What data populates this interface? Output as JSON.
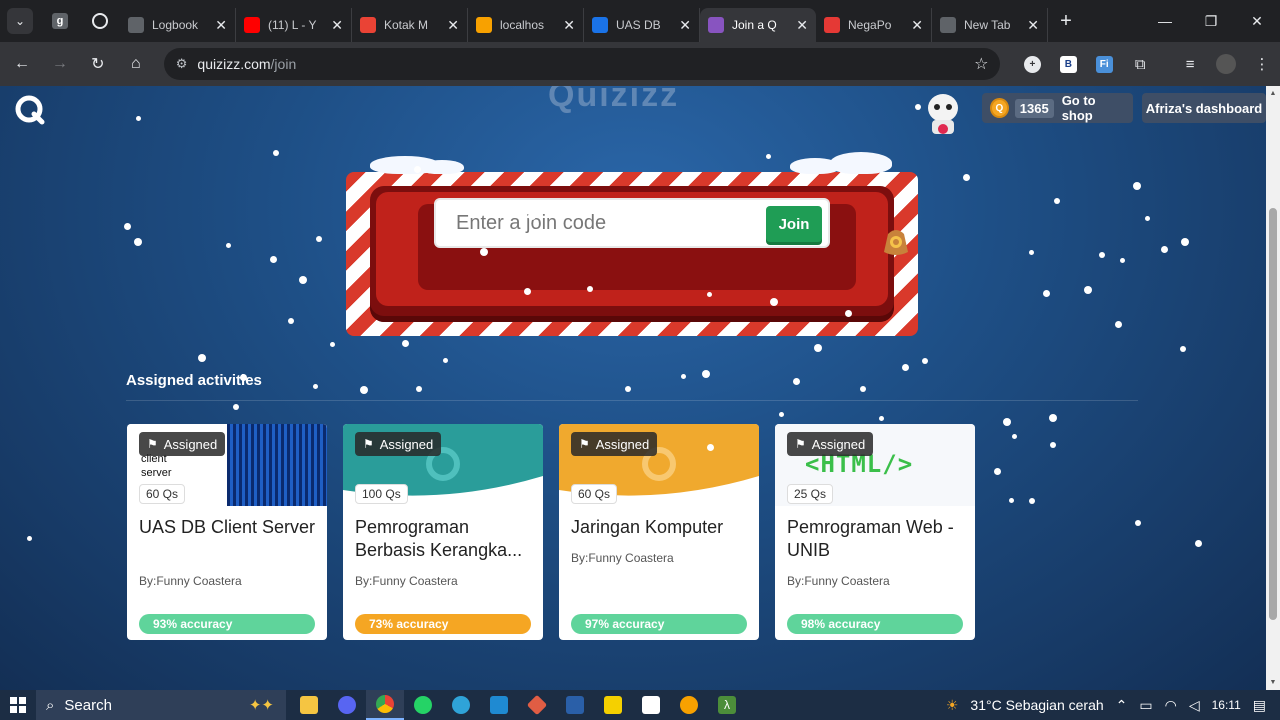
{
  "browser": {
    "tabs": [
      {
        "title": "",
        "favicon": "g-icon",
        "color": "#6b6b6b",
        "pinned": true
      },
      {
        "title": "",
        "favicon": "openai-icon",
        "color": "#202124",
        "pinned": true
      },
      {
        "title": "Logbook",
        "favicon": "globe-icon",
        "color": "#5f6368"
      },
      {
        "title": "(11) L - Y",
        "favicon": "youtube-icon",
        "color": "#ff0000"
      },
      {
        "title": "Kotak M",
        "favicon": "gmail-icon",
        "color": "#ea4335"
      },
      {
        "title": "localhos",
        "favicon": "xampp-icon",
        "color": "#f8a100"
      },
      {
        "title": "UAS DB",
        "favicon": "classroom-icon",
        "color": "#1a73e8"
      },
      {
        "title": "Join a Q",
        "favicon": "quizizz-icon",
        "color": "#8854c0",
        "active": true
      },
      {
        "title": "NegaPo",
        "favicon": "negapo-icon",
        "color": "#e53935"
      },
      {
        "title": "New Tab",
        "favicon": "chrome-icon",
        "color": "#5f6368"
      }
    ],
    "url_host": "quizizz.com",
    "url_path": "/join"
  },
  "header": {
    "logo_text": "Quizizz",
    "coins": "1365",
    "shop_label": "Go to shop",
    "dashboard_label": "Afriza's dashboard"
  },
  "join": {
    "placeholder": "Enter a join code",
    "button_label": "Join"
  },
  "assigned": {
    "title": "Assigned activities",
    "badge_label": "Assigned",
    "cards": [
      {
        "title": "UAS DB Client Server",
        "questions": "60 Qs",
        "author": "By:Funny Coastera",
        "accuracy": "93% accuracy",
        "acc_color": "#5fd49b",
        "thumb": "database",
        "thumb_text1": "client",
        "thumb_text2": "server"
      },
      {
        "title": "Pemrograman Berbasis Kerangka...",
        "questions": "100 Qs",
        "author": "By:Funny Coastera",
        "accuracy": "73% accuracy",
        "acc_color": "#f5a623",
        "thumb": "teal"
      },
      {
        "title": "Jaringan Komputer",
        "questions": "60 Qs",
        "author": "By:Funny Coastera",
        "accuracy": "97% accuracy",
        "acc_color": "#5fd49b",
        "thumb": "orange"
      },
      {
        "title": "Pemrograman Web - UNIB",
        "questions": "25 Qs",
        "author": "By:Funny Coastera",
        "accuracy": "98% accuracy",
        "acc_color": "#5fd49b",
        "thumb": "html",
        "thumb_text1": "<HTML/>"
      }
    ]
  },
  "taskbar": {
    "search_label": "Search",
    "weather": "31°C  Sebagian cerah",
    "time": "16:11"
  }
}
